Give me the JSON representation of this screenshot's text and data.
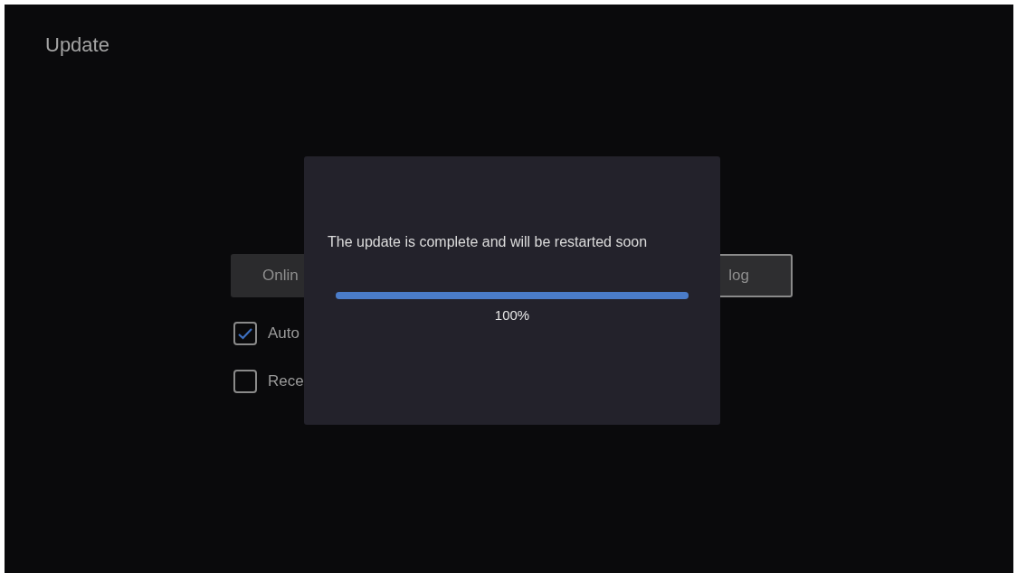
{
  "screen": {
    "title": "Update"
  },
  "background_buttons": [
    {
      "label": "Onlin",
      "focused": false
    },
    {
      "label": "log",
      "focused": true
    }
  ],
  "options": [
    {
      "label": "Auto",
      "checked": true
    },
    {
      "label": "Rece",
      "checked": false
    }
  ],
  "dialog": {
    "message": "The update is complete and will be restarted soon",
    "progress": {
      "level": 1,
      "reading": "100%"
    }
  }
}
